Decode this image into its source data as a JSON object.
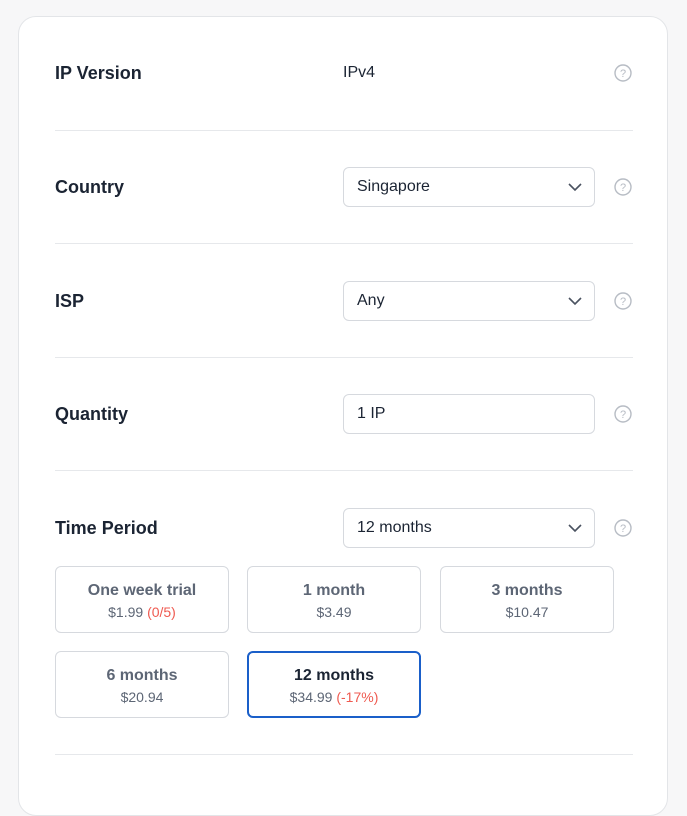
{
  "rows": {
    "ip_version": {
      "label": "IP Version",
      "value": "IPv4"
    },
    "country": {
      "label": "Country",
      "value": "Singapore"
    },
    "isp": {
      "label": "ISP",
      "value": "Any"
    },
    "quantity": {
      "label": "Quantity",
      "value": "1 IP"
    },
    "time_period": {
      "label": "Time Period",
      "value": "12 months"
    }
  },
  "periods": [
    {
      "title": "One week trial",
      "price": "$1.99",
      "note": "(0/5)",
      "selected": false
    },
    {
      "title": "1 month",
      "price": "$3.49",
      "note": "",
      "selected": false
    },
    {
      "title": "3 months",
      "price": "$10.47",
      "note": "",
      "selected": false
    },
    {
      "title": "6 months",
      "price": "$20.94",
      "note": "",
      "selected": false
    },
    {
      "title": "12 months",
      "price": "$34.99",
      "note": "(-17%)",
      "selected": true
    }
  ],
  "icons": {
    "help": "question-circle-icon",
    "dropdown": "chevron-down-icon"
  },
  "colors": {
    "accent": "#1a5fc9",
    "discount": "#ef5a50"
  }
}
